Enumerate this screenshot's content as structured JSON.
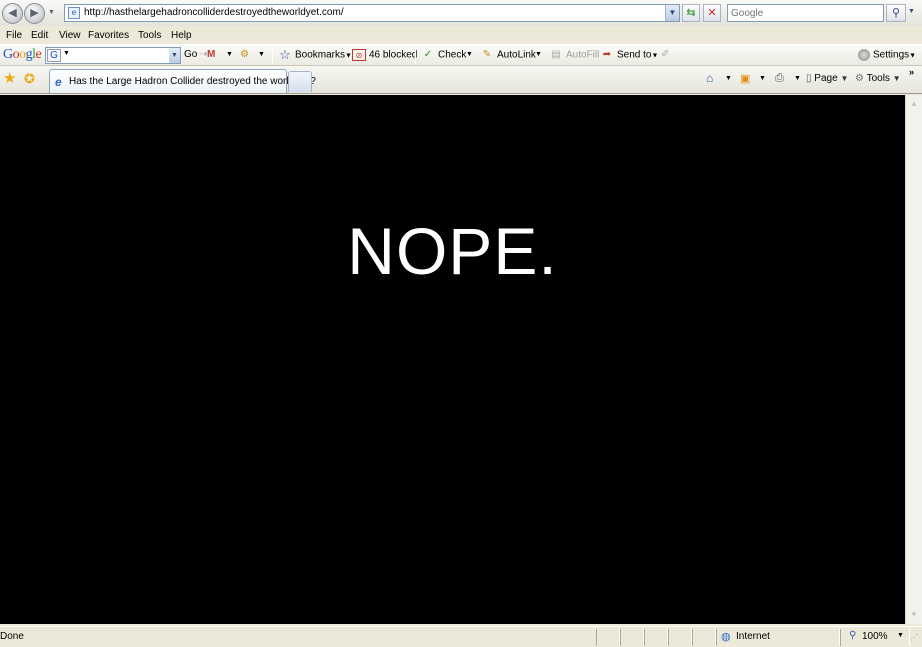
{
  "address_bar": {
    "back_icon": "back-arrow-icon",
    "forward_icon": "forward-arrow-icon",
    "url": "http://hasthelargehadroncolliderdestroyedtheworldyet.com/",
    "search_placeholder": "Google"
  },
  "menu": {
    "items": [
      "File",
      "Edit",
      "View",
      "Favorites",
      "Tools",
      "Help"
    ]
  },
  "google_toolbar": {
    "logo": [
      "G",
      "o",
      "o",
      "g",
      "l",
      "e"
    ],
    "go_label": "Go",
    "bookmarks_label": "Bookmarks",
    "blocked_label": "46 blocked",
    "check_label": "Check",
    "autolink_label": "AutoLink",
    "autofill_label": "AutoFill",
    "sendto_label": "Send to",
    "settings_label": "Settings"
  },
  "tabs": {
    "active_title": "Has the Large Hadron Collider destroyed the world yet?"
  },
  "command_bar": {
    "page_label": "Page",
    "tools_label": "Tools"
  },
  "page": {
    "headline": "NOPE."
  },
  "status_bar": {
    "status": "Done",
    "zone": "Internet",
    "zoom": "100%"
  },
  "colors": {
    "page_background": "#000000",
    "headline_color": "#ffffff",
    "chrome": "#ece9d8"
  }
}
